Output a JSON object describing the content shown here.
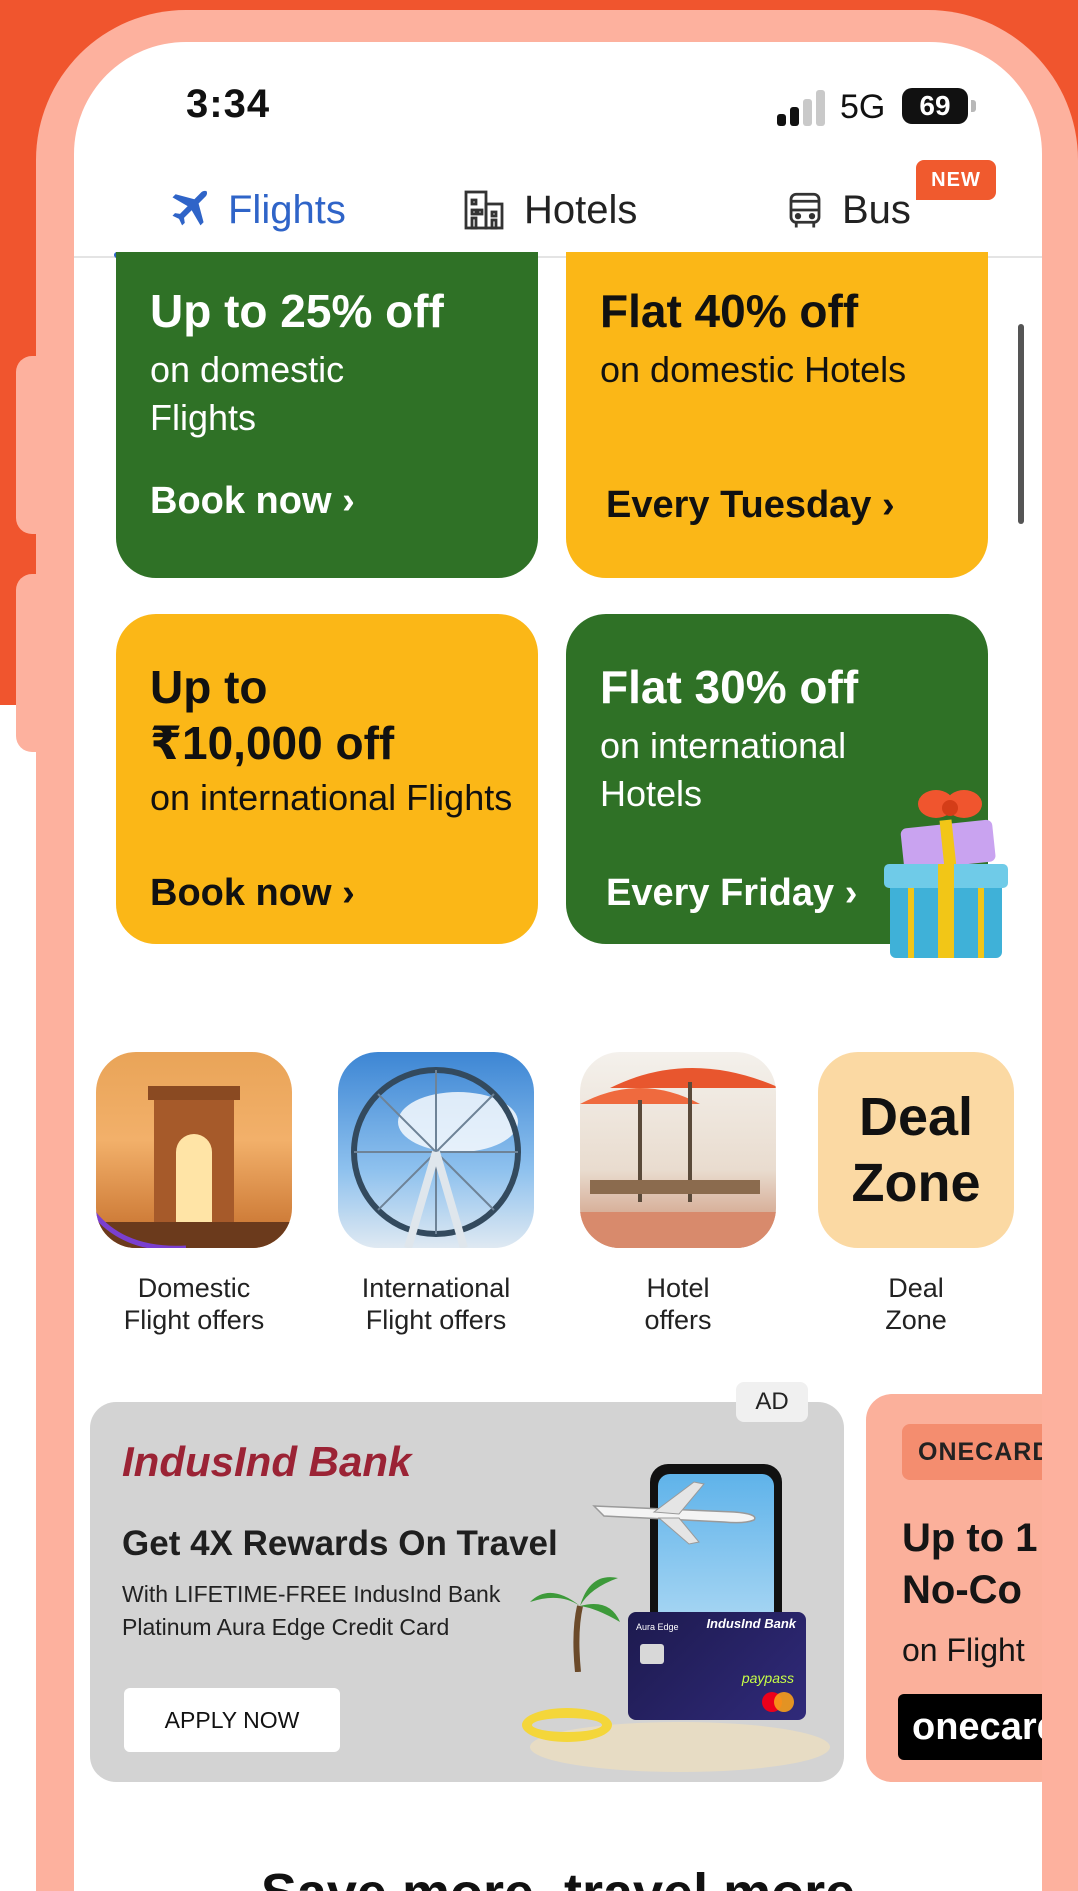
{
  "status_bar": {
    "time": "3:34",
    "network": "5G",
    "battery": "69"
  },
  "tabs": [
    {
      "label": "Flights",
      "icon": "airplane-icon",
      "active": true
    },
    {
      "label": "Hotels",
      "icon": "building-icon",
      "active": false
    },
    {
      "label": "Bus",
      "icon": "bus-icon",
      "active": false,
      "badge": "NEW"
    }
  ],
  "offers": [
    {
      "headline": "Up to 25% off",
      "sub_line1": "on domestic",
      "sub_line2": "Flights",
      "cta": "Book now",
      "color": "#2f7126"
    },
    {
      "headline": "Flat 40% off",
      "sub_line1": "on domestic Hotels",
      "cta": "Every Tuesday",
      "color": "#fbb717"
    },
    {
      "headline_line1": "Up to",
      "headline_line2": "₹10,000 off",
      "sub_line1": "on international Flights",
      "cta": "Book now",
      "color": "#fbb717"
    },
    {
      "headline": "Flat 30% off",
      "sub_line1": "on international",
      "sub_line2": "Hotels",
      "cta": "Every Friday",
      "color": "#2f7126"
    }
  ],
  "categories": [
    {
      "line1": "Domestic",
      "line2": "Flight offers",
      "icon": "india-gate-icon"
    },
    {
      "line1": "International",
      "line2": "Flight offers",
      "icon": "ferris-wheel-icon"
    },
    {
      "line1": "Hotel",
      "line2": "offers",
      "icon": "beach-umbrella-icon"
    },
    {
      "line1": "Deal",
      "line2": "Zone",
      "icon": "deal-zone-icon",
      "tile_text_1": "Deal",
      "tile_text_2": "Zone"
    }
  ],
  "ad_banner": {
    "tag": "AD",
    "brand": "IndusInd Bank",
    "headline": "Get 4X Rewards On Travel",
    "sub_line1": "With LIFETIME-FREE IndusInd Bank",
    "sub_line2": "Platinum Aura Edge Credit Card",
    "cta": "APPLY NOW",
    "card_brand": "IndusInd Bank",
    "card_name": "Aura Edge",
    "card_feature": "paypass"
  },
  "ad_banner_2": {
    "pill": "ONECARD",
    "line1": "Up to 1",
    "line2": "No-Co",
    "line3": "on Flight",
    "logo": "onecard"
  },
  "section_title": "Save more, travel more",
  "colors": {
    "accent": "#2f64c8",
    "green": "#2f7126",
    "yellow": "#fbb717",
    "orange": "#f0552e",
    "badge": "#f05a2e"
  }
}
